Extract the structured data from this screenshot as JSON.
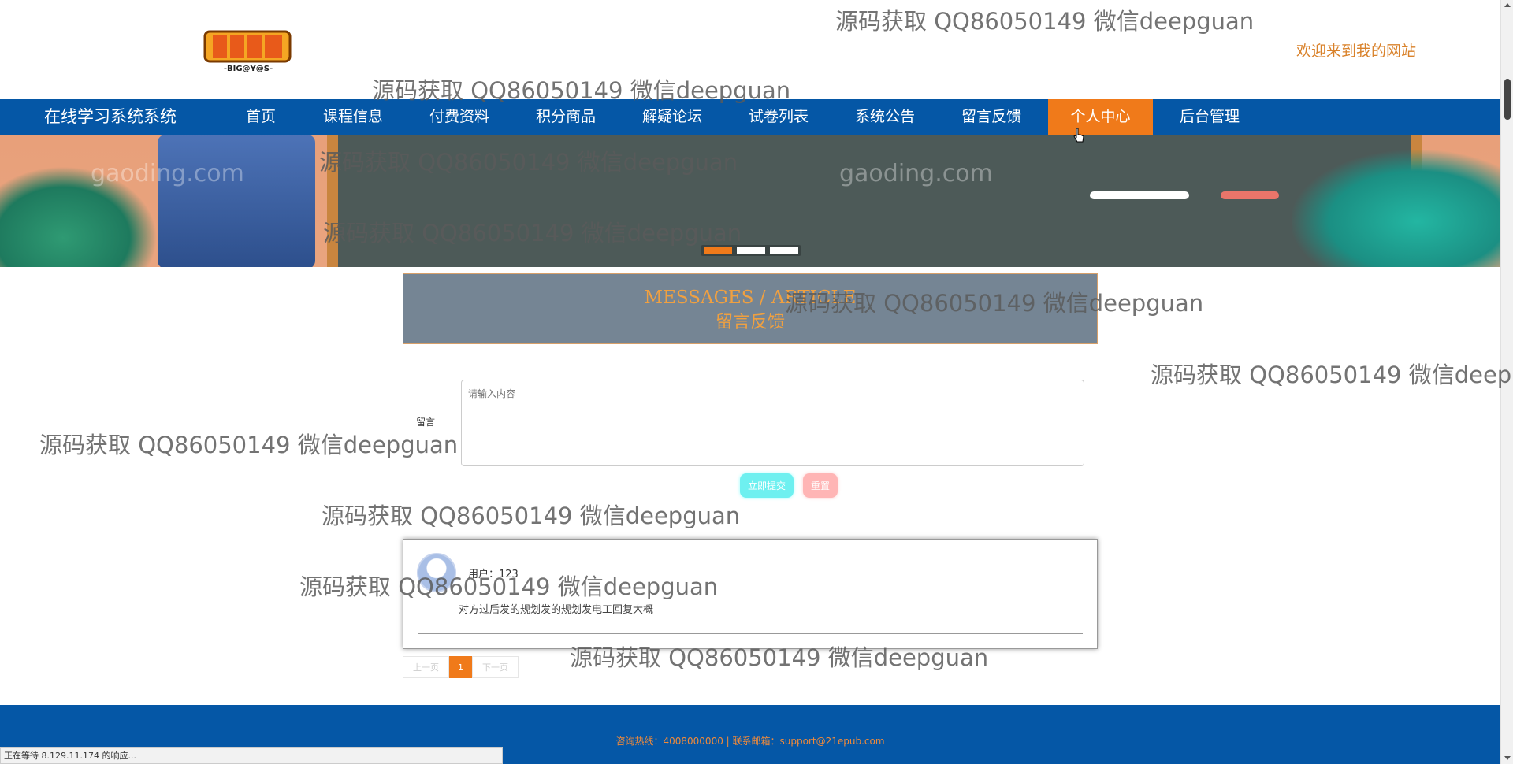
{
  "header": {
    "welcome": "欢迎来到我的网站",
    "logo_text": "BIGEYES"
  },
  "nav": {
    "brand": "在线学习系统系统",
    "items": [
      "首页",
      "课程信息",
      "付费资料",
      "积分商品",
      "解疑论坛",
      "试卷列表",
      "系统公告",
      "留言反馈",
      "个人中心",
      "后台管理"
    ],
    "active": "个人中心"
  },
  "banner": {
    "site_marks": [
      "gaoding.com",
      "gaoding.com"
    ],
    "active_dot": 1,
    "dot_count": 3
  },
  "messages": {
    "title_en": "MESSAGES / ARTICLE",
    "title_cn": "留言反馈"
  },
  "form": {
    "label": "留言",
    "placeholder": "请输入内容",
    "submit_label": "立即提交",
    "reset_label": "重置"
  },
  "comments": [
    {
      "user": "用户：123",
      "text": "对方过后发的规划发的规划发电工回复大概"
    }
  ],
  "pager": {
    "prev_label": "上一页",
    "current": "1",
    "next_label": "下一页"
  },
  "footer": {
    "text": "咨询热线：4008000000 | 联系邮箱：support@21epub.com"
  },
  "status": {
    "text": "正在等待 8.129.11.174 的响应..."
  },
  "watermarks": [
    "源码获取 QQ86050149 微信deepguan",
    "源码获取 QQ86050149 微信deepguan",
    "源码获取 QQ86050149 微信deepguan",
    "源码获取 QQ86050149 微信deepguan",
    "源码获取 QQ86050149 微信deepguan",
    "源码获取 QQ86050149 微信deep",
    "源码获取 QQ86050149 微信deepguan",
    "源码获取 QQ86050149 微信deepguan",
    "源码获取 QQ86050149 微信deepguan",
    "源码获取 QQ86050149 微信deepguan"
  ],
  "colors": {
    "nav_bg": "#0557a6",
    "accent": "#f07a1a",
    "title_box": "#758594"
  }
}
